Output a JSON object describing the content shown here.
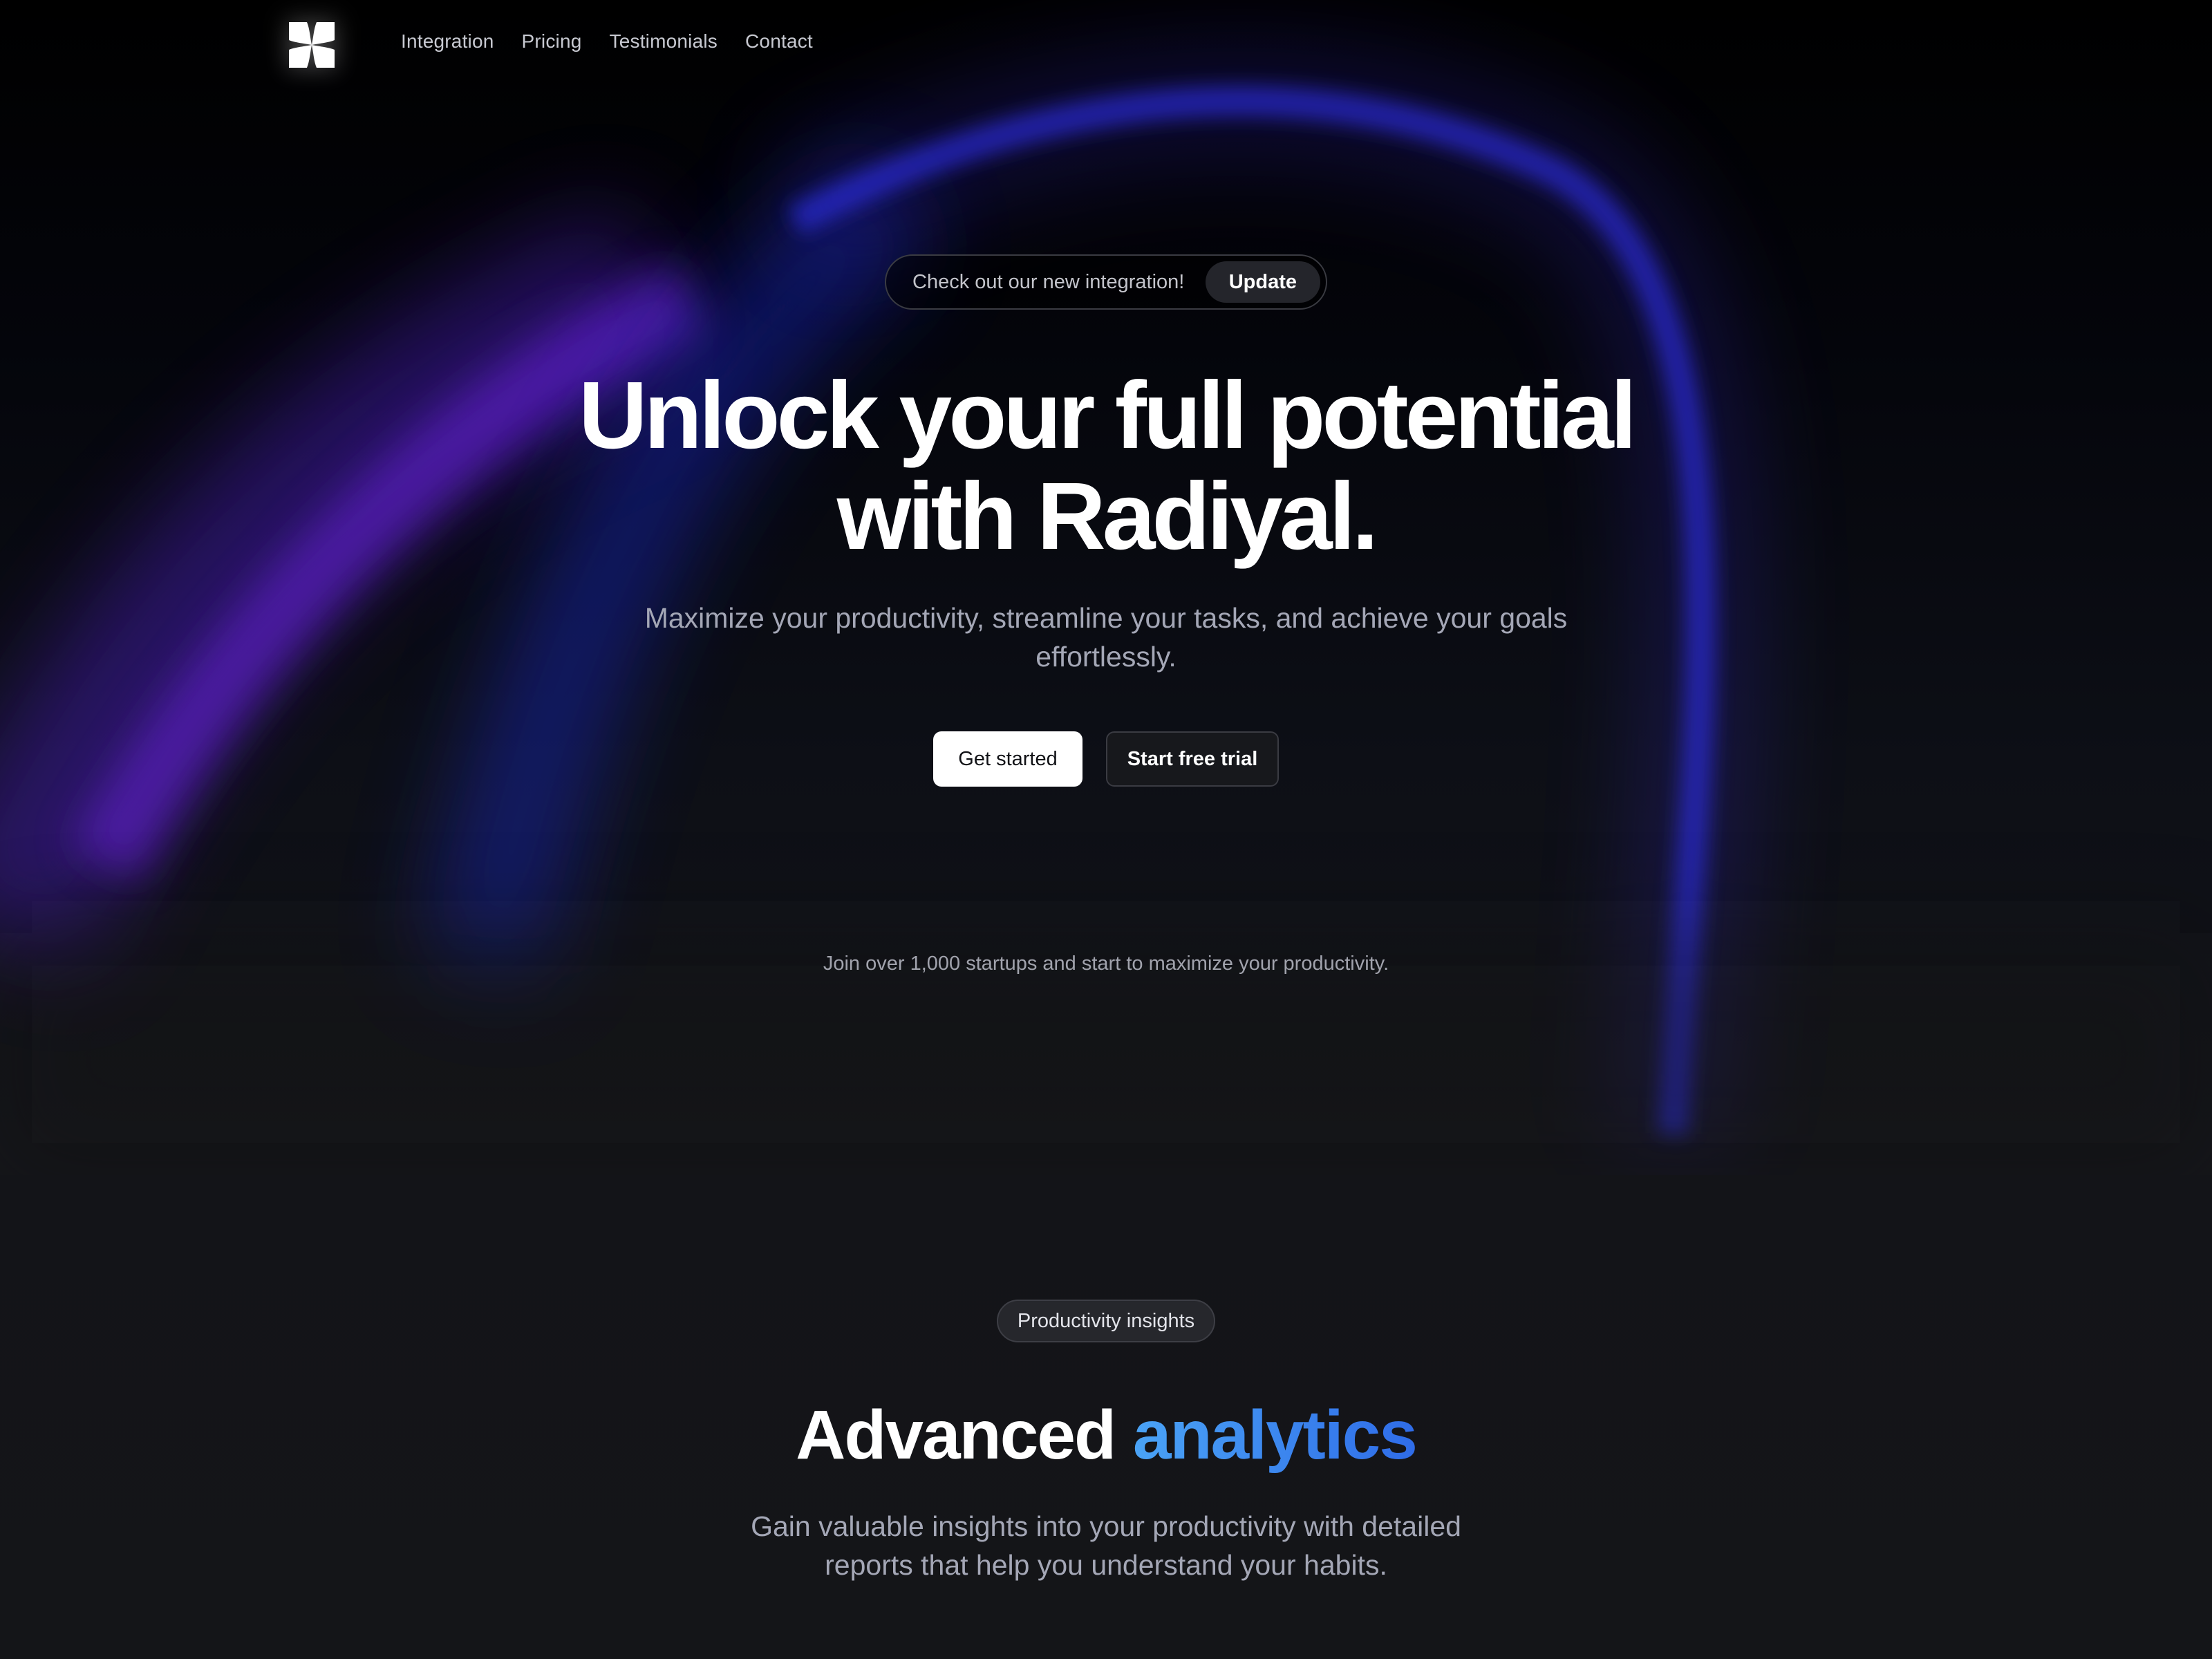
{
  "nav": {
    "links": [
      {
        "label": "Integration"
      },
      {
        "label": "Pricing"
      },
      {
        "label": "Testimonials"
      },
      {
        "label": "Contact"
      }
    ]
  },
  "announcement": {
    "text": "Check out our new integration!",
    "button": "Update"
  },
  "hero": {
    "title_line1": "Unlock your full potential",
    "title_line2": "with Radiyal.",
    "subtitle": "Maximize your productivity, streamline your tasks, and achieve your goals effortlessly.",
    "primary_cta": "Get started",
    "secondary_cta": "Start free trial",
    "social_proof": "Join over 1,000 startups and start to maximize your productivity."
  },
  "analytics": {
    "badge": "Productivity insights",
    "title_plain": "Advanced ",
    "title_accent": "analytics",
    "subtitle": "Gain valuable insights into your productivity with detailed reports that help you understand your habits."
  },
  "colors": {
    "background": "#141518",
    "accent_blue": "#3b82f6",
    "glow_purple": "#5b1fd6",
    "glow_blue": "#1c2bd9"
  },
  "icons": {
    "logo": "pinwheel-logo-icon"
  }
}
